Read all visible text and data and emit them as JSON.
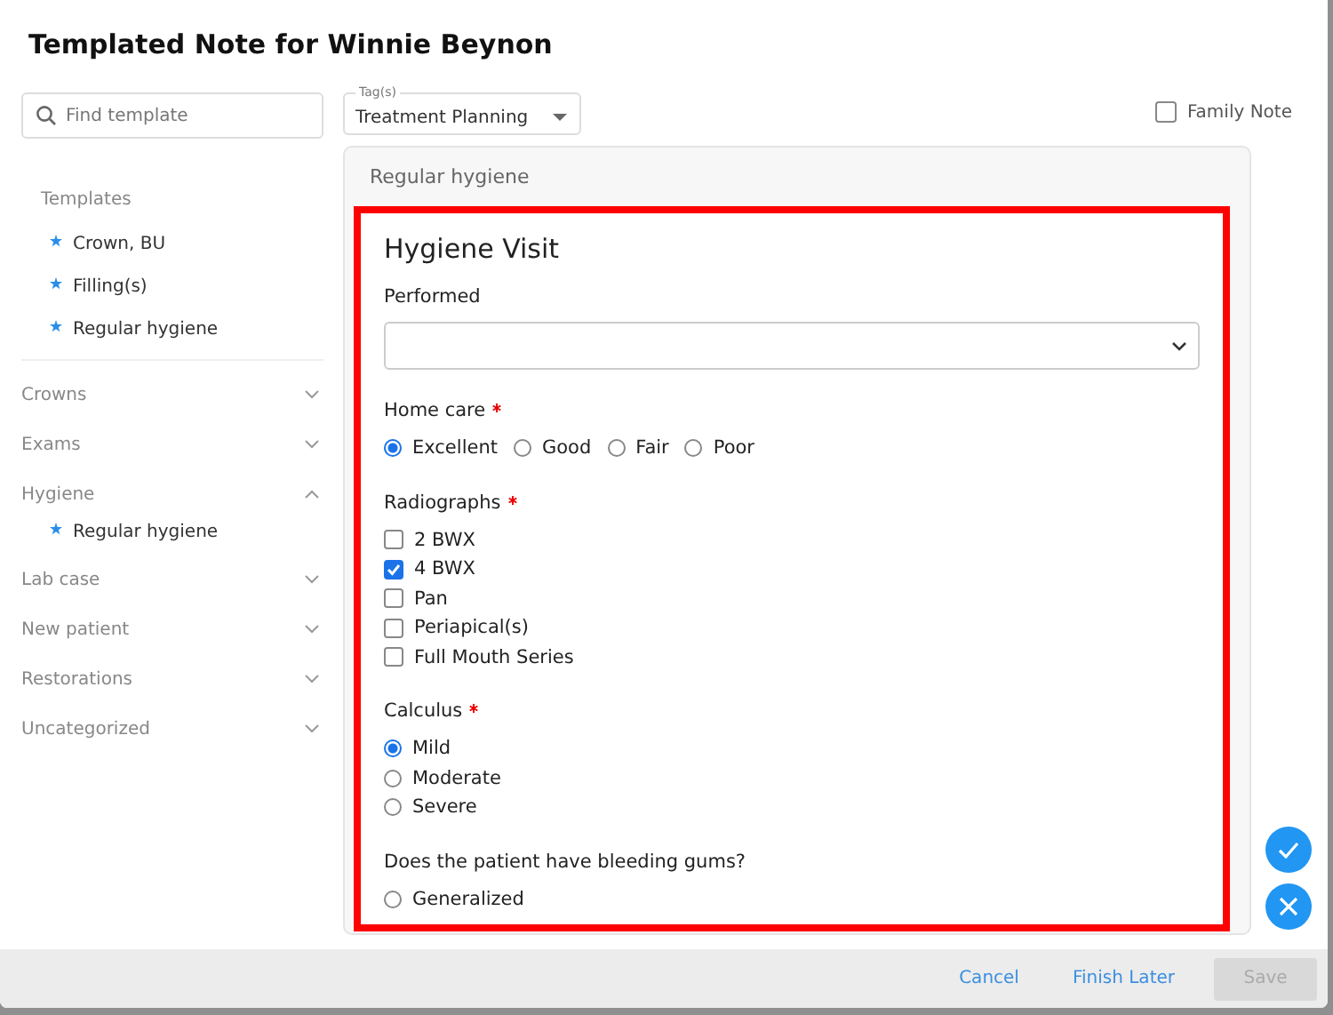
{
  "window": {
    "title": "Templated Note for Winnie Beynon"
  },
  "sidebar": {
    "search": {
      "placeholder": "Find template"
    },
    "templates_heading": "Templates",
    "templates": [
      {
        "label": "Crown, BU"
      },
      {
        "label": "Filling(s)"
      },
      {
        "label": "Regular hygiene"
      }
    ],
    "categories": [
      {
        "label": "Crowns",
        "expanded": false
      },
      {
        "label": "Exams",
        "expanded": false
      },
      {
        "label": "Hygiene",
        "expanded": true,
        "children": [
          {
            "label": "Regular hygiene"
          }
        ]
      },
      {
        "label": "Lab case",
        "expanded": false
      },
      {
        "label": "New patient",
        "expanded": false
      },
      {
        "label": "Restorations",
        "expanded": false
      },
      {
        "label": "Uncategorized",
        "expanded": false
      }
    ]
  },
  "tags": {
    "label": "Tag(s)",
    "value": "Treatment Planning"
  },
  "family_note": {
    "label": "Family Note",
    "checked": false
  },
  "panel": {
    "title": "Regular hygiene",
    "form_title": "Hygiene Visit",
    "fields": [
      {
        "kind": "select",
        "label": "Performed",
        "required": false
      },
      {
        "kind": "radio-inline",
        "label": "Home care",
        "required": true,
        "options": [
          {
            "label": "Excellent",
            "selected": true
          },
          {
            "label": "Good",
            "selected": false
          },
          {
            "label": "Fair",
            "selected": false
          },
          {
            "label": "Poor",
            "selected": false
          }
        ]
      },
      {
        "kind": "checkbox",
        "label": "Radiographs",
        "required": true,
        "options": [
          {
            "label": "2 BWX",
            "checked": false
          },
          {
            "label": "4 BWX",
            "checked": true
          },
          {
            "label": "Pan",
            "checked": false
          },
          {
            "label": "Periapical(s)",
            "checked": false
          },
          {
            "label": "Full Mouth Series",
            "checked": false
          }
        ]
      },
      {
        "kind": "radio",
        "label": "Calculus",
        "required": true,
        "options": [
          {
            "label": "Mild",
            "selected": true
          },
          {
            "label": "Moderate",
            "selected": false
          },
          {
            "label": "Severe",
            "selected": false
          }
        ]
      },
      {
        "kind": "radio",
        "label": "Does the patient have bleeding gums?",
        "required": false,
        "options": [
          {
            "label": "Generalized",
            "selected": false
          }
        ]
      }
    ]
  },
  "footer": {
    "buttons": [
      {
        "label": "Cancel",
        "disabled": false
      },
      {
        "label": "Finish Later",
        "disabled": false
      },
      {
        "label": "Save",
        "disabled": true
      }
    ]
  }
}
